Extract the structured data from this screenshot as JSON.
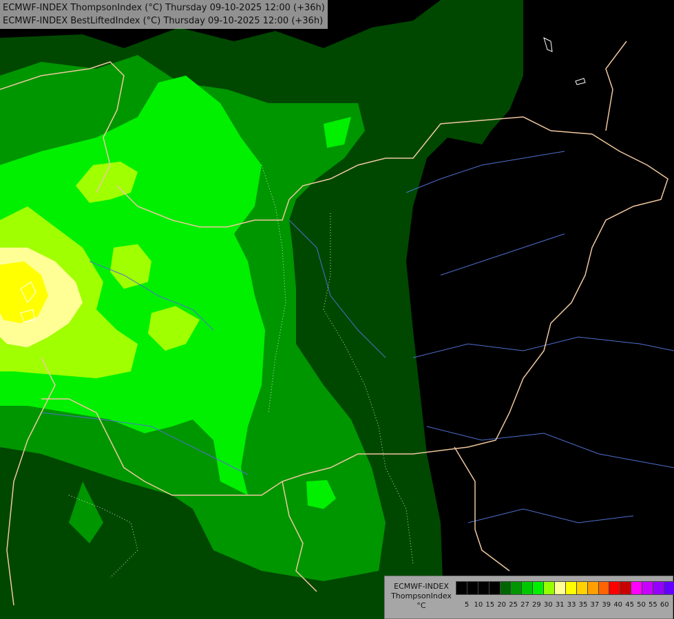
{
  "titles": [
    "ECMWF-INDEX ThompsonIndex (°C) Thursday 09-10-2025 12:00 (+36h)",
    "ECMWF-INDEX BestLiftedIndex (°C) Thursday 09-10-2025 12:00 (+36h)"
  ],
  "legend": {
    "model": "ECMWF-INDEX",
    "parameter": "ThompsonIndex",
    "unit": "°C",
    "colors": [
      "#000000",
      "#000000",
      "#000000",
      "#000000",
      "#006400",
      "#009600",
      "#00c800",
      "#00f000",
      "#96ff00",
      "#ffff96",
      "#ffff00",
      "#ffd200",
      "#ffa000",
      "#ff6400",
      "#ff0000",
      "#c80000",
      "#ff00ff",
      "#c800ff",
      "#9600ff",
      "#6400ff",
      "#0000ff"
    ],
    "ticks": [
      "5",
      "10",
      "15",
      "20",
      "25",
      "27",
      "29",
      "30",
      "31",
      "33",
      "35",
      "37",
      "39",
      "40",
      "45",
      "50",
      "55",
      "60"
    ]
  },
  "map_colors": {
    "background": "#000000",
    "dark_green": "#004800",
    "mid_green": "#009600",
    "light_green": "#00f000",
    "yellow_green": "#a0ff00",
    "pale_yellow": "#ffff96",
    "yellow": "#ffff00",
    "borders": "#f0c8a0",
    "rivers": "#5070d0",
    "coast": "#ffffff"
  }
}
